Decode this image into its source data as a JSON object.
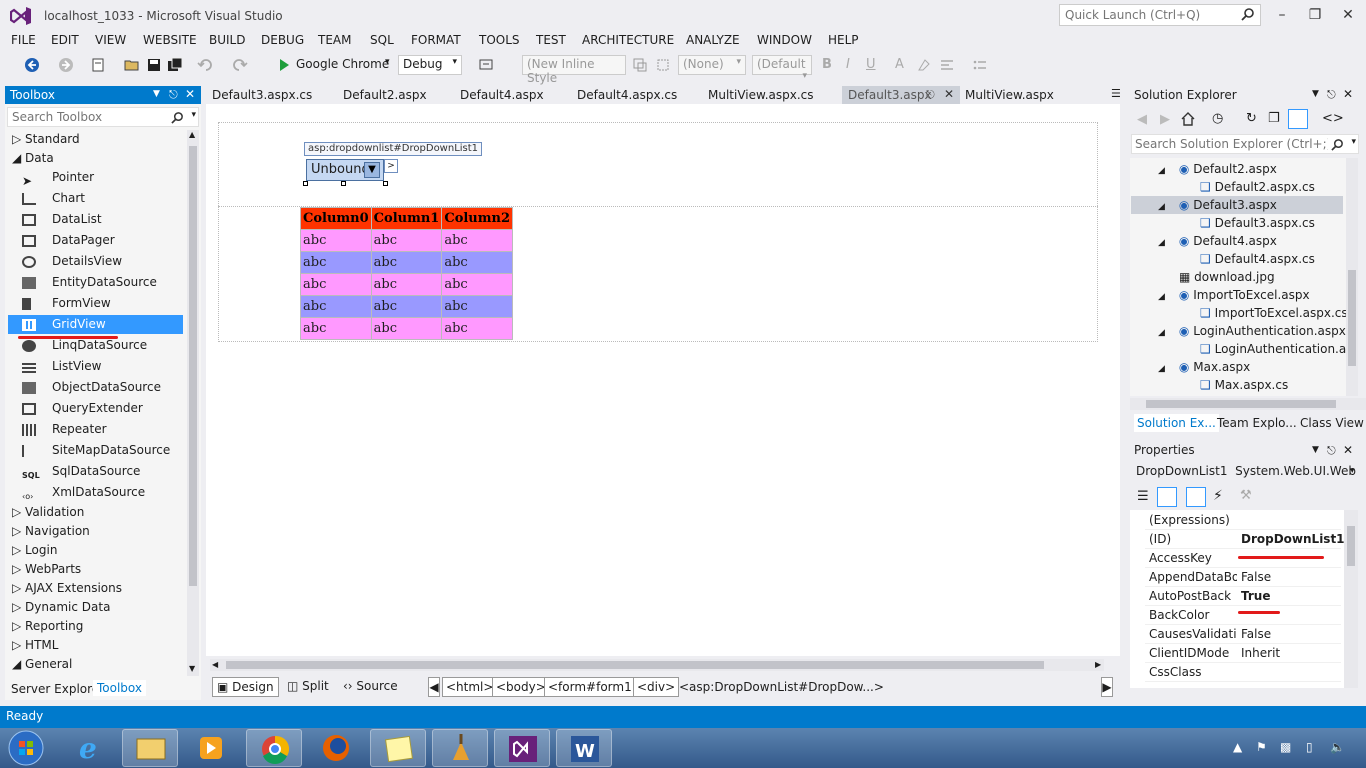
{
  "window": {
    "title": "localhost_1033 - Microsoft Visual Studio",
    "quick_launch_placeholder": "Quick Launch (Ctrl+Q)"
  },
  "menu": [
    "FILE",
    "EDIT",
    "VIEW",
    "WEBSITE",
    "BUILD",
    "DEBUG",
    "TEAM",
    "SQL",
    "FORMAT",
    "TOOLS",
    "TEST",
    "ARCHITECTURE",
    "ANALYZE",
    "WINDOW",
    "HELP"
  ],
  "toolbar": {
    "run_target": "Google Chrome",
    "config": "Debug",
    "style_box": "(New Inline Style",
    "target_rule": "(None)",
    "font_box": "(Default",
    "bold": "B",
    "italic": "I",
    "underline": "U",
    "font_color": "A"
  },
  "toolbox": {
    "title": "Toolbox",
    "search_placeholder": "Search Toolbox",
    "categories_top": [
      "Standard",
      "Data"
    ],
    "data_items": [
      "Pointer",
      "Chart",
      "DataList",
      "DataPager",
      "DetailsView",
      "EntityDataSource",
      "FormView",
      "GridView",
      "LinqDataSource",
      "ListView",
      "ObjectDataSource",
      "QueryExtender",
      "Repeater",
      "SiteMapDataSource",
      "SqlDataSource",
      "XmlDataSource"
    ],
    "categories_bottom": [
      "Validation",
      "Navigation",
      "Login",
      "WebParts",
      "AJAX Extensions",
      "Dynamic Data",
      "Reporting",
      "HTML",
      "General"
    ],
    "selected": "GridView",
    "bottom_tabs": [
      "Server Explorer",
      "Toolbox"
    ]
  },
  "tabs": [
    "Default3.aspx.cs",
    "Default2.aspx",
    "Default4.aspx",
    "Default4.aspx.cs",
    "MultiView.aspx.cs",
    "Default3.aspx",
    "MultiView.aspx"
  ],
  "active_tab": "Default3.aspx",
  "designer": {
    "ddl_label": "asp:dropdownlist#DropDownList1",
    "ddl_value": "Unbound",
    "grid_headers": [
      "Column0",
      "Column1",
      "Column2"
    ],
    "grid_rows": [
      [
        "abc",
        "abc",
        "abc"
      ],
      [
        "abc",
        "abc",
        "abc"
      ],
      [
        "abc",
        "abc",
        "abc"
      ],
      [
        "abc",
        "abc",
        "abc"
      ],
      [
        "abc",
        "abc",
        "abc"
      ]
    ],
    "header_color": "#ff3300",
    "row_color_a": "#ff99ff",
    "row_color_b": "#9999ff"
  },
  "view_buttons": [
    "Design",
    "Split",
    "Source"
  ],
  "breadcrumbs": [
    "<html>",
    "<body>",
    "<form#form1>",
    "<div>",
    "<asp:DropDownList#DropDow...>"
  ],
  "solution_explorer": {
    "title": "Solution Explorer",
    "search_placeholder": "Search Solution Explorer (Ctrl+;)",
    "items": [
      {
        "label": "Default2.aspx",
        "level": 1,
        "expander": "◢"
      },
      {
        "label": "Default2.aspx.cs",
        "level": 2,
        "expander": ""
      },
      {
        "label": "Default3.aspx",
        "level": 1,
        "expander": "◢"
      },
      {
        "label": "Default3.aspx.cs",
        "level": 2,
        "expander": ""
      },
      {
        "label": "Default4.aspx",
        "level": 1,
        "expander": "◢"
      },
      {
        "label": "Default4.aspx.cs",
        "level": 2,
        "expander": ""
      },
      {
        "label": "download.jpg",
        "level": 1,
        "expander": ""
      },
      {
        "label": "ImportToExcel.aspx",
        "level": 1,
        "expander": "◢"
      },
      {
        "label": "ImportToExcel.aspx.cs",
        "level": 2,
        "expander": ""
      },
      {
        "label": "LoginAuthentication.aspx",
        "level": 1,
        "expander": "◢"
      },
      {
        "label": "LoginAuthentication.asp",
        "level": 2,
        "expander": ""
      },
      {
        "label": "Max.aspx",
        "level": 1,
        "expander": "◢"
      },
      {
        "label": "Max.aspx.cs",
        "level": 2,
        "expander": ""
      }
    ],
    "selected": "Default3.aspx",
    "bottom_tabs": [
      "Solution Ex...",
      "Team Explo...",
      "Class View"
    ]
  },
  "properties": {
    "title": "Properties",
    "object_name": "DropDownList1",
    "object_type": "System.Web.UI.WebC",
    "rows": [
      {
        "name": "(Expressions)",
        "value": "",
        "bold": false
      },
      {
        "name": "(ID)",
        "value": "DropDownList1",
        "bold": true
      },
      {
        "name": "AccessKey",
        "value": "",
        "bold": false
      },
      {
        "name": "AppendDataBou",
        "value": "False",
        "bold": false
      },
      {
        "name": "AutoPostBack",
        "value": "True",
        "bold": true
      },
      {
        "name": "BackColor",
        "value": "",
        "bold": false
      },
      {
        "name": "CausesValidatior",
        "value": "False",
        "bold": false
      },
      {
        "name": "ClientIDMode",
        "value": "Inherit",
        "bold": false
      },
      {
        "name": "CssClass",
        "value": "",
        "bold": false
      }
    ]
  },
  "status": "Ready",
  "accent_color": "#007acc",
  "annotation_color": "#e21a1a"
}
